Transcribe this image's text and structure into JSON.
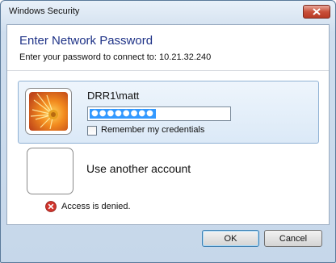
{
  "window": {
    "title": "Windows Security"
  },
  "dialog": {
    "heading": "Enter Network Password",
    "subtitle": "Enter your password to connect to: 10.21.32.240"
  },
  "account": {
    "user": "DRR1\\matt",
    "password_masked": "●●●●●●●●",
    "remember_label": "Remember my credentials",
    "remember_checked": false
  },
  "other_account": {
    "label": "Use another account"
  },
  "error": {
    "text": "Access is denied."
  },
  "buttons": {
    "ok": "OK",
    "cancel": "Cancel"
  },
  "colors": {
    "heading": "#1e3287",
    "selection": "#3399ff",
    "error": "#d0342c"
  }
}
